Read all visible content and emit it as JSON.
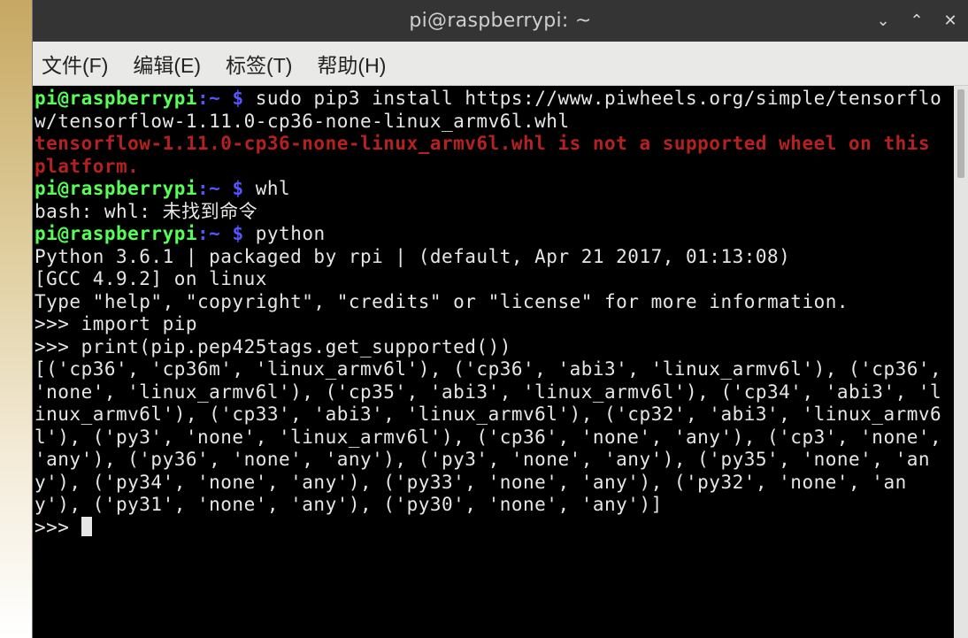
{
  "window": {
    "title": "pi@raspberrypi: ~"
  },
  "menubar": {
    "file": "文件(F)",
    "edit": "编辑(E)",
    "tabs": "标签(T)",
    "help": "帮助(H)"
  },
  "prompt": {
    "userhost": "pi@raspberrypi",
    "colon": ":",
    "path": "~",
    "dollar": " $ "
  },
  "terminal": {
    "cmd1": "sudo pip3 install https://www.piwheels.org/simple/tensorflow/tensorflow-1.11.0-cp36-none-linux_armv6l.whl",
    "err1": "tensorflow-1.11.0-cp36-none-linux_armv6l.whl is not a supported wheel on this platform.",
    "cmd2": "whl",
    "bash1": "bash: whl: 未找到命令",
    "cmd3": "python",
    "py1": "Python 3.6.1 | packaged by rpi | (default, Apr 21 2017, 01:13:08)",
    "py2": "[GCC 4.9.2] on linux",
    "py3": "Type \"help\", \"copyright\", \"credits\" or \"license\" for more information.",
    "repl1": ">>> import pip",
    "repl2": ">>> print(pip.pep425tags.get_supported())",
    "out1": "[('cp36', 'cp36m', 'linux_armv6l'), ('cp36', 'abi3', 'linux_armv6l'), ('cp36', 'none', 'linux_armv6l'), ('cp35', 'abi3', 'linux_armv6l'), ('cp34', 'abi3', 'linux_armv6l'), ('cp33', 'abi3', 'linux_armv6l'), ('cp32', 'abi3', 'linux_armv6l'), ('py3', 'none', 'linux_armv6l'), ('cp36', 'none', 'any'), ('cp3', 'none', 'any'), ('py36', 'none', 'any'), ('py3', 'none', 'any'), ('py35', 'none', 'any'), ('py34', 'none', 'any'), ('py33', 'none', 'any'), ('py32', 'none', 'any'), ('py31', 'none', 'any'), ('py30', 'none', 'any')]",
    "repl3": ">>> "
  },
  "colors": {
    "prompt_user": "#55ff55",
    "prompt_path": "#5555ff",
    "error": "#b52121",
    "fg": "#e6e6e6",
    "bg": "#000000",
    "titlebar": "#343434"
  }
}
